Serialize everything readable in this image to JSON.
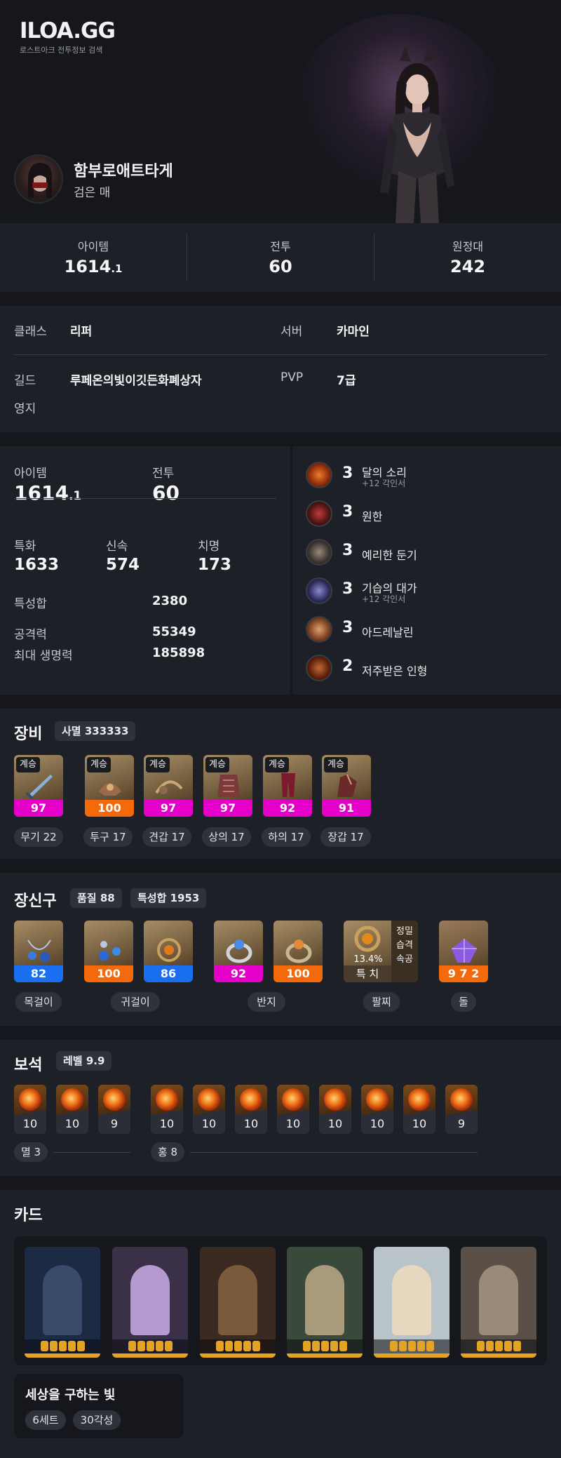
{
  "site": {
    "logo": "ILOA.GG",
    "subtitle": "로스트아크 전투정보 검색"
  },
  "character": {
    "name": "함부로애트타게",
    "title": "검은 매"
  },
  "summary": [
    {
      "label": "아이템",
      "value": "1614",
      "decimal": ".1"
    },
    {
      "label": "전투",
      "value": "60",
      "decimal": ""
    },
    {
      "label": "원정대",
      "value": "242",
      "decimal": ""
    }
  ],
  "info": {
    "class_label": "클래스",
    "class_value": "리퍼",
    "server_label": "서버",
    "server_value": "카마인",
    "guild_label": "길드",
    "guild_value": "루페온의빛이깃든화폐상자",
    "pvp_label": "PVP",
    "pvp_value": "7급",
    "territory_label": "영지"
  },
  "stats": {
    "item_label": "아이템",
    "item_value": "1614",
    "item_decimal": ".1",
    "combat_label": "전투",
    "combat_value": "60",
    "spec_label": "특화",
    "spec_value": "1633",
    "swift_label": "신속",
    "swift_value": "574",
    "crit_label": "치명",
    "crit_value": "173",
    "trait_total_label": "특성합",
    "trait_total_value": "2380",
    "attack_label": "공격력",
    "attack_value": "55349",
    "hp_label": "최대 생명력",
    "hp_value": "185898"
  },
  "engravings": [
    {
      "level": "3",
      "name": "달의 소리",
      "sub": "+12 각인서",
      "icon": "moon-sound-icon",
      "color": "#c8431a"
    },
    {
      "level": "3",
      "name": "원한",
      "sub": "",
      "icon": "grudge-icon",
      "color": "#8a2a2a"
    },
    {
      "level": "3",
      "name": "예리한 둔기",
      "sub": "",
      "icon": "keen-blunt-icon",
      "color": "#6a5a4a"
    },
    {
      "level": "3",
      "name": "기습의 대가",
      "sub": "+12 각인서",
      "icon": "ambush-master-icon",
      "color": "#4a4a8a"
    },
    {
      "level": "3",
      "name": "아드레날린",
      "sub": "",
      "icon": "adrenaline-icon",
      "color": "#a8602a"
    },
    {
      "level": "2",
      "name": "저주받은 인형",
      "sub": "",
      "icon": "cursed-doll-icon",
      "color": "#8a3a1a"
    }
  ],
  "equipment": {
    "title": "장비",
    "set_chip": "사멸 333333",
    "items": [
      {
        "tag": "계승",
        "quality": "97",
        "label": "무기 22",
        "quality_color": "#e400c8"
      },
      {
        "tag": "계승",
        "quality": "100",
        "label": "투구 17",
        "quality_color": "#f46a0a"
      },
      {
        "tag": "계승",
        "quality": "97",
        "label": "견갑 17",
        "quality_color": "#e400c8"
      },
      {
        "tag": "계승",
        "quality": "97",
        "label": "상의 17",
        "quality_color": "#e400c8"
      },
      {
        "tag": "계승",
        "quality": "92",
        "label": "하의 17",
        "quality_color": "#e400c8"
      },
      {
        "tag": "계승",
        "quality": "91",
        "label": "장갑 17",
        "quality_color": "#e400c8"
      }
    ]
  },
  "accessories": {
    "title": "장신구",
    "quality_chip": "품질 88",
    "trait_chip": "특성합 1953",
    "items": [
      {
        "quality": "82",
        "quality_color": "#1a6ef0"
      },
      {
        "quality": "100",
        "quality_color": "#f46a0a"
      },
      {
        "quality": "86",
        "quality_color": "#1a6ef0"
      },
      {
        "quality": "92",
        "quality_color": "#e400c8"
      },
      {
        "quality": "100",
        "quality_color": "#f46a0a"
      }
    ],
    "bracelet": {
      "percent": "13.4%",
      "stats": "특 치",
      "effects": [
        "정밀",
        "습격",
        "속공"
      ]
    },
    "stone": {
      "value": "9 7 2"
    },
    "labels": [
      "목걸이",
      "귀걸이",
      "반지",
      "팔찌",
      "돌"
    ]
  },
  "gems": {
    "title": "보석",
    "level_chip": "레벨 9.9",
    "annihilation": {
      "label": "멸 3",
      "levels": [
        "10",
        "10",
        "9"
      ]
    },
    "crimson": {
      "label": "홍 8",
      "levels": [
        "10",
        "10",
        "10",
        "10",
        "10",
        "10",
        "10",
        "9"
      ]
    }
  },
  "cards": {
    "title": "카드",
    "set_name": "세상을 구하는 빛",
    "set_tags": [
      "6세트",
      "30각성"
    ],
    "items": [
      {
        "stars": 5,
        "bg": "#1d2a44",
        "fig": "#3a4a6a"
      },
      {
        "stars": 5,
        "bg": "#3a3048",
        "fig": "#b59ad0"
      },
      {
        "stars": 5,
        "bg": "#3a2a22",
        "fig": "#7a5a3a"
      },
      {
        "stars": 5,
        "bg": "#3a4a3a",
        "fig": "#a89a7a"
      },
      {
        "stars": 5,
        "bg": "#b8c4c8",
        "fig": "#e8d8c0"
      },
      {
        "stars": 5,
        "bg": "#5a5048",
        "fig": "#9a8a7a"
      }
    ]
  }
}
